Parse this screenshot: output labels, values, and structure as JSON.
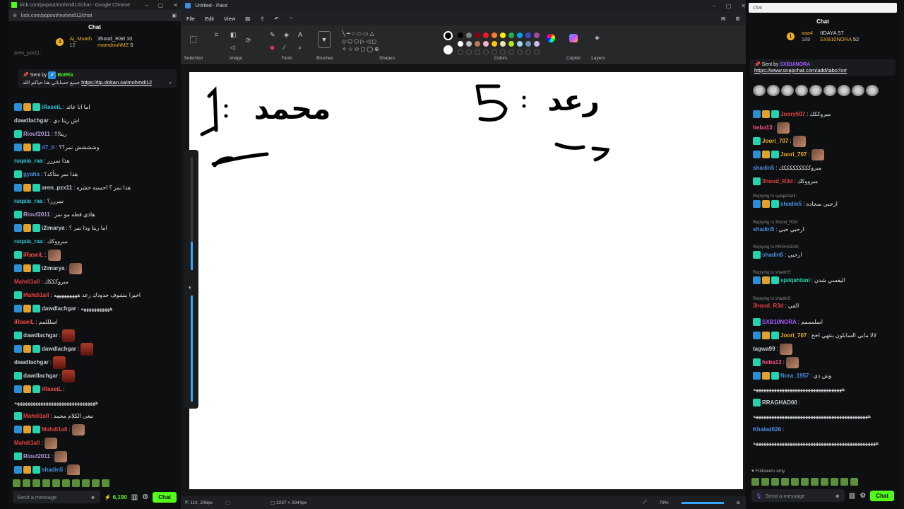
{
  "left_window": {
    "title": "kick.com/popout/mohmdi12/chat - Google Chrome",
    "url": "kick.com/popout/mohmdi12/chat",
    "chat_title": "Chat",
    "top_users": [
      {
        "name": "Aj_Muath",
        "count": "12"
      },
      {
        "name": "3hood_R3d",
        "count": "10"
      },
      {
        "name": "mamdouhMZ",
        "count": "5"
      }
    ],
    "partial_line": "aren_pzx11:",
    "pinned": {
      "sent_by": "Sent by",
      "sender": "BotRix",
      "text": "جميع حساباتي هنا حياكم الله",
      "link": "https://tip.dokan.sa/mohmdi12"
    },
    "messages": [
      {
        "user": "iRaseiL",
        "text": "اما انا عائد",
        "color": "#2ec6d6"
      },
      {
        "user": "dawdlachgar",
        "text": "اش ريتا دي",
        "color": "#c5cdd5"
      },
      {
        "user": "Riouf2011",
        "text": "!!!ريتا",
        "color": "#b39ddb"
      },
      {
        "user": "d7_li",
        "text": "وشششش نمر؟؟",
        "color": "#5c7cfa"
      },
      {
        "user": "ruqaia_raa",
        "text": "هذا نمررر",
        "color": "#2ec6d6"
      },
      {
        "user": "gyaha",
        "text": "هذا نمر متأكد؟",
        "color": "#4a90e2"
      },
      {
        "user": "aren_pzx11",
        "text": "هذا نمر ؟ احسبه حشره",
        "color": "#c5cdd5"
      },
      {
        "user": "ruqaia_raa",
        "text": "نمررر؟",
        "color": "#2ec6d6"
      },
      {
        "user": "Riouf2011",
        "text": "هاذي قطه مو نمر",
        "color": "#b39ddb"
      },
      {
        "user": "i2imarya",
        "text": "اما ريتا وذا نمر ؟",
        "color": "#c5cdd5"
      },
      {
        "user": "ruqaia_raa",
        "text": "مبرووكك",
        "color": "#2ec6d6"
      },
      {
        "user": "iRaseiL",
        "text": "",
        "color": "#ff4f4f",
        "emote": true
      },
      {
        "user": "i2imarya",
        "text": "",
        "color": "#c5cdd5",
        "emote": true
      },
      {
        "user": "Mahdi1all",
        "text": "مبروكككك",
        "color": "#e64242"
      },
      {
        "user": "Mahdi1all",
        "text": "اخيرا بنشوف حدودك رعد هههههههههه",
        "color": "#e64242"
      },
      {
        "user": "dawdlachgar",
        "text": "هههههههههههه",
        "color": "#c5cdd5"
      },
      {
        "user": "iRaseiL",
        "text": "اسلللمم",
        "color": "#ff4f4f"
      },
      {
        "user": "dawdlachgar",
        "text": "",
        "color": "#c5cdd5",
        "gif": true
      },
      {
        "user": "dawdlachgar",
        "text": "",
        "color": "#c5cdd5",
        "gif": true
      },
      {
        "user": "dawdlachgar",
        "text": "",
        "color": "#c5cdd5",
        "gif": true
      },
      {
        "user": "dawdlachgar",
        "text": "",
        "color": "#c5cdd5",
        "gif": true
      },
      {
        "user": "iRaseiL",
        "text": "",
        "color": "#ff4f4f"
      },
      {
        "user": "",
        "text": "هههههههههههههههههههههههههههههههه",
        "color": "#c5cdd5"
      },
      {
        "user": "Mahdi1all",
        "text": "نبغى الكلام محمد",
        "color": "#e64242"
      },
      {
        "user": "Mahdi1all",
        "text": "",
        "color": "#e64242",
        "emote": true
      },
      {
        "user": "Mahdi1all",
        "text": "",
        "color": "#e64242",
        "emote": true
      },
      {
        "user": "Riouf2011",
        "text": "",
        "color": "#b39ddb",
        "emote": true
      },
      {
        "user": "shadin5",
        "text": "",
        "color": "#4a90e2",
        "emote": true
      }
    ],
    "input_placeholder": "Send a message",
    "points": "6,190",
    "chat_button": "Chat"
  },
  "paint": {
    "title": "Untitled - Paint",
    "menu": [
      "File",
      "Edit",
      "View"
    ],
    "groups": [
      "Selection",
      "Image",
      "Tools",
      "Brushes",
      "Shapes",
      "Colors",
      "Copilot",
      "Layers"
    ],
    "canvas_text": {
      "left_num": "1",
      "left_name": "محمد",
      "right_num": "5",
      "right_name": "رعد",
      "right_sub": "د"
    },
    "status": {
      "cursor": "110, 206px",
      "size": "2237 × 2944px",
      "zoom": "79%"
    }
  },
  "right_window": {
    "search_placeholder": "chat",
    "chat_title": "Chat",
    "top_users": [
      {
        "name": "xaa4",
        "count": "188"
      },
      {
        "name": "IIDAYA",
        "count": "57"
      },
      {
        "name": "SXB10NORA",
        "count": "52"
      }
    ],
    "pinned": {
      "sent_by": "Sent by",
      "sender": "SXB10NORA",
      "link": "https://www.snapchat.com/add/iabo7orr"
    },
    "messages": [
      {
        "user": "Joory507",
        "text": "مبروككك",
        "color": "#e64242"
      },
      {
        "user": "heba13",
        "text": "",
        "color": "#ff4f8b",
        "emote": true
      },
      {
        "user": "Joori_707",
        "text": "",
        "color": "#f2b01e",
        "emote": true
      },
      {
        "user": "Joori_707",
        "text": "",
        "color": "#f2b01e",
        "emote": true
      },
      {
        "user": "shadin5",
        "text": "مبروكككككككككك",
        "color": "#4a90e2"
      },
      {
        "user": "3hood_R3d",
        "text": "مبرووكك",
        "color": "#e64242"
      },
      {
        "reply": "Replying to sjalqahtani:",
        "user": "shadin5",
        "text": "ارحبي سجاده",
        "color": "#4a90e2"
      },
      {
        "reply": "Replying to 3hood_R3d:",
        "user": "shadin5",
        "text": "ارحبي حبي",
        "color": "#4a90e2"
      },
      {
        "reply": "Replying to RRGHAD00:",
        "user": "shadin5",
        "text": "ارحبي",
        "color": "#4a90e2"
      },
      {
        "reply": "Replying to shadin5:",
        "user": "sjalqahtani",
        "text": "اليقسي شدن",
        "color": "#24d3b0"
      },
      {
        "reply": "Replying to shadin5:",
        "user": "3hood_R3d",
        "text": "الفي",
        "color": "#e64242"
      },
      {
        "user": "SXB10NORA",
        "text": "اسلمممم",
        "color": "#a35cff"
      },
      {
        "user": "Joori_707",
        "text": "لالا مابي السابلون بنتهي اخخ",
        "color": "#f2b01e"
      },
      {
        "user": "tagwa99",
        "text": "",
        "color": "#c5cdd5",
        "emote": true
      },
      {
        "user": "heba13",
        "text": "",
        "color": "#ff4f8b",
        "emote": true
      },
      {
        "user": "Nora_1957",
        "text": "وش ذي",
        "color": "#4a90e2"
      },
      {
        "user": "",
        "text": "ههههههههههههههههههههههههههههههههههه",
        "color": "#c5cdd5"
      },
      {
        "user": "RRAGHAD00",
        "text": "",
        "color": "#c5cdd5"
      },
      {
        "user": "",
        "text": "ههههههههههههههههههههههههههههههههههههههههههههه",
        "color": "#c5cdd5"
      },
      {
        "user": "Khaled026",
        "text": "",
        "color": "#4a90e2"
      },
      {
        "user": "",
        "text": "هههههههههههههههههههههههههههههههههههههههههههههههه",
        "color": "#c5cdd5"
      }
    ],
    "followers_only": "Followers only",
    "input_placeholder": "Send a message",
    "chat_button": "Chat"
  }
}
